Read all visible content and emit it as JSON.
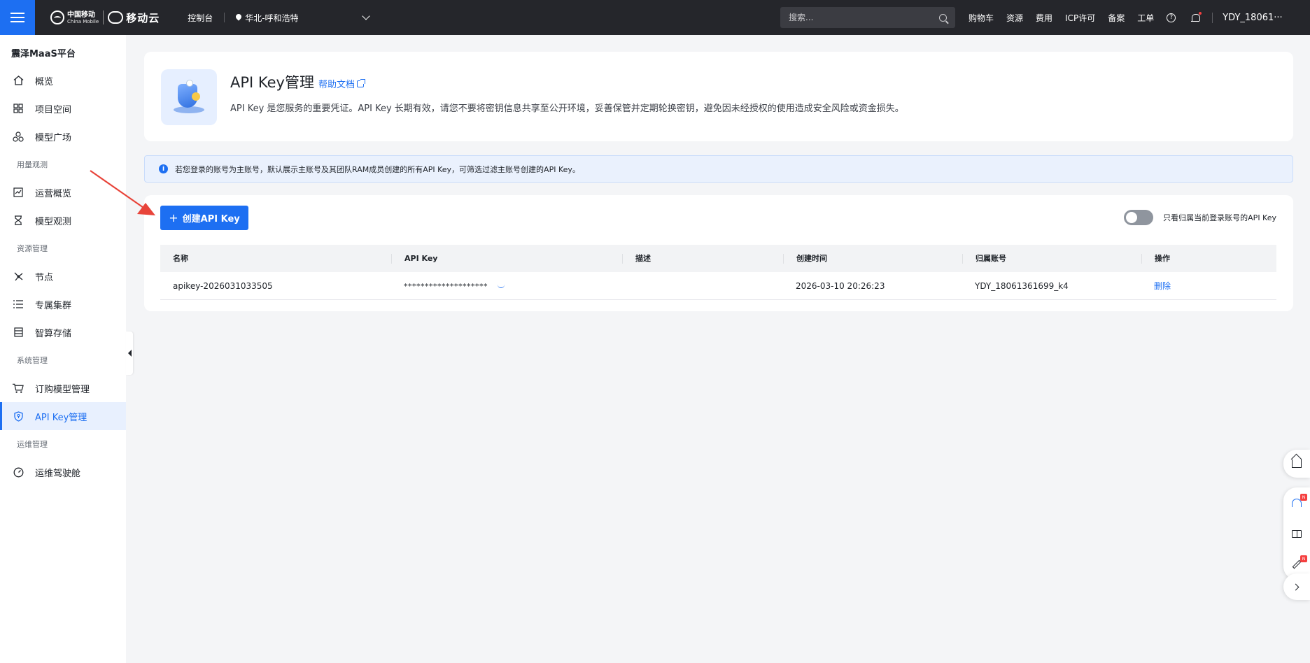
{
  "topbar": {
    "brand_cn": "中国移动",
    "brand_en": "China Mobile",
    "brand_cloud": "移动云",
    "console": "控制台",
    "region": "华北-呼和浩特",
    "search_placeholder": "搜索...",
    "links": [
      "购物车",
      "资源",
      "费用",
      "ICP许可",
      "备案",
      "工单"
    ],
    "help_glyph": "?",
    "user": "YDY_18061···",
    "accent": "#1d6ff2"
  },
  "sidebar": {
    "platform": "震泽MaaS平台",
    "items_top": [
      {
        "label": "概览",
        "icon": "home-icon"
      },
      {
        "label": "项目空间",
        "icon": "grid-icon"
      },
      {
        "label": "模型广场",
        "icon": "cluster-icon"
      }
    ],
    "group_usage": "用量观测",
    "items_usage": [
      {
        "label": "运营概览",
        "icon": "chart-icon"
      },
      {
        "label": "模型观测",
        "icon": "hourglass-icon"
      }
    ],
    "group_resource": "资源管理",
    "items_resource": [
      {
        "label": "节点",
        "icon": "node-icon"
      },
      {
        "label": "专属集群",
        "icon": "list-icon"
      },
      {
        "label": "智算存储",
        "icon": "storage-icon"
      }
    ],
    "group_system": "系统管理",
    "items_system": [
      {
        "label": "订购模型管理",
        "icon": "cart-icon"
      },
      {
        "label": "API Key管理",
        "icon": "shield-icon",
        "active": true
      }
    ],
    "group_ops": "运维管理",
    "items_ops": [
      {
        "label": "运维驾驶舱",
        "icon": "dashboard-icon"
      }
    ]
  },
  "header": {
    "title": "API Key管理",
    "help_link": "帮助文档",
    "description": "API Key 是您服务的重要凭证。API Key 长期有效，请您不要将密钥信息共享至公开环境，妥善保管并定期轮换密钥，避免因未经授权的使用造成安全风险或资金损失。"
  },
  "notice": {
    "icon_glyph": "i",
    "text": "若您登录的账号为主账号，默认展示主账号及其团队RAM成员创建的所有API Key，可筛选过滤主账号创建的API Key。"
  },
  "list": {
    "create_button": "创建API Key",
    "plus_glyph": "+",
    "filter_label": "只看归属当前登录账号的API Key",
    "filter_on": false,
    "columns": [
      "名称",
      "API Key",
      "描述",
      "创建时间",
      "归属账号",
      "操作"
    ],
    "rows": [
      {
        "name": "apikey-2026031033505",
        "key": "********************",
        "description": "",
        "created": "2026-03-10 20:26:23",
        "owner": "YDY_18061361699_k4",
        "action": "删除"
      }
    ]
  },
  "floating_tools": {
    "badge_new": "N"
  }
}
